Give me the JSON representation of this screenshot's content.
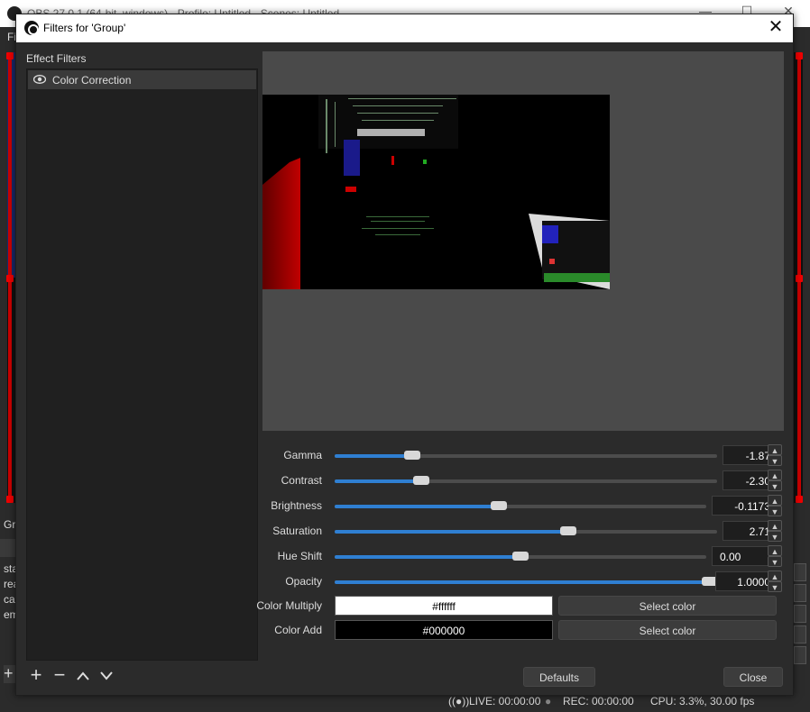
{
  "main_window": {
    "title": "OBS 27.0.1 (64-bit, windows) - Profile: Untitled - Scenes: Untitled",
    "menu_first": "Fi",
    "lower_left_label": "Gr",
    "log_lines": [
      "sta",
      "rea",
      "ca",
      "em"
    ],
    "status": {
      "live": "LIVE: 00:00:00",
      "rec": "REC: 00:00:00",
      "cpu": "CPU: 3.3%, 30.00 fps"
    }
  },
  "dialog": {
    "title": "Filters for 'Group'",
    "effect_filters_label": "Effect Filters",
    "filters": [
      {
        "label": "Color Correction",
        "visible": true
      }
    ],
    "properties": {
      "gamma": {
        "label": "Gamma",
        "value": "-1.87",
        "fraction": 0.203
      },
      "contrast": {
        "label": "Contrast",
        "value": "-2.30",
        "fraction": 0.226
      },
      "brightness": {
        "label": "Brightness",
        "value": "-0.1173",
        "fraction": 0.441
      },
      "saturation": {
        "label": "Saturation",
        "value": "2.71",
        "fraction": 0.611
      },
      "hue_shift": {
        "label": "Hue Shift",
        "value": "0.00",
        "fraction": 0.5
      },
      "opacity": {
        "label": "Opacity",
        "value": "1.0000",
        "fraction": 1.0
      },
      "color_multiply": {
        "label": "Color Multiply",
        "value": "#ffffff",
        "button": "Select color"
      },
      "color_add": {
        "label": "Color Add",
        "value": "#000000",
        "button": "Select color"
      }
    },
    "buttons": {
      "defaults": "Defaults",
      "close": "Close"
    },
    "colors": {
      "accent": "#2f7fd2",
      "panel": "#2b2b2b"
    }
  }
}
